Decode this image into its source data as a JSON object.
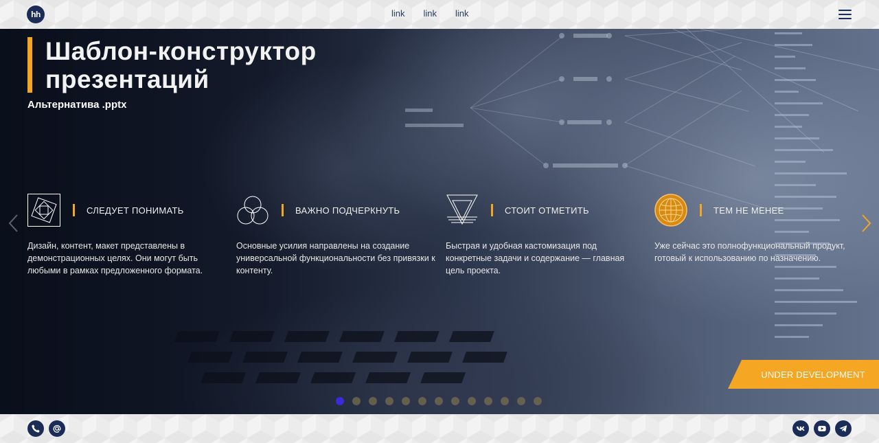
{
  "header": {
    "logo_text": "hh",
    "nav_links": [
      "link",
      "link",
      "link"
    ],
    "menu_icon": "hamburger-icon"
  },
  "hero": {
    "title_line1": "Шаблон-конструктор",
    "title_line2": "презентаций",
    "subtitle": "Альтернатива .pptx",
    "features": [
      {
        "icon": "nested-squares-icon",
        "heading": "СЛЕДУЕТ ПОНИМАТЬ",
        "text": "Дизайн, контент, макет представлены в демонстрационных целях. Они могут быть любыми в рамках предложенного формата."
      },
      {
        "icon": "three-circles-icon",
        "heading": "ВАЖНО ПОДЧЕРКНУТЬ",
        "text": "Основные усилия направлены на создание универсальной функциональности без привязки к контенту."
      },
      {
        "icon": "triangles-icon",
        "heading": "СТОИТ ОТМЕТИТЬ",
        "text": "Быстрая и удобная кастомизация под конкретные задачи и содержание — главная цель проекта."
      },
      {
        "icon": "globe-icon",
        "heading": "ТЕМ НЕ МЕНЕЕ",
        "text": "Уже сейчас это полнофункциональный продукт, готовый к использованию по назначению."
      }
    ],
    "badge_text": "UNDER DEVELOPMENT",
    "slider": {
      "total_slides": 13,
      "active_index": 1
    }
  },
  "footer": {
    "left_icons": [
      "phone-icon",
      "email-icon"
    ],
    "right_icons": [
      "vk-icon",
      "youtube-icon",
      "telegram-icon"
    ]
  },
  "colors": {
    "accent": "#f5a623",
    "brand_navy": "#1b2d57",
    "active_dot": "#3a2bd6"
  }
}
